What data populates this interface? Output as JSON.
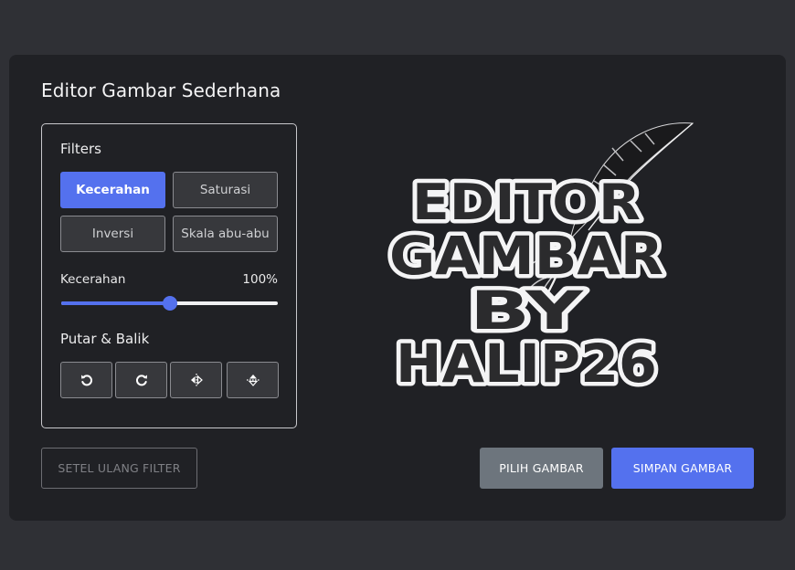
{
  "app": {
    "title": "Editor Gambar Sederhana"
  },
  "filters": {
    "heading": "Filters",
    "buttons": [
      {
        "label": "Kecerahan",
        "active": true
      },
      {
        "label": "Saturasi",
        "active": false
      },
      {
        "label": "Inversi",
        "active": false
      },
      {
        "label": "Skala abu-abu",
        "active": false
      }
    ],
    "slider": {
      "name": "Kecerahan",
      "value_text": "100%",
      "fraction": 0.5
    }
  },
  "rotate_flip": {
    "heading": "Putar & Balik",
    "icons": [
      "rotate-left-icon",
      "rotate-right-icon",
      "flip-horizontal-icon",
      "flip-vertical-icon"
    ]
  },
  "actions": {
    "reset": "SETEL ULANG FILTER",
    "choose": "PILIH GAMBAR",
    "save": "SIMPAN GAMBAR"
  },
  "preview_image": {
    "lines": [
      "EDITOR",
      "GAMBAR",
      "BY",
      "HALIP26"
    ]
  },
  "colors": {
    "accent": "#5471ee",
    "background": "#2f3035",
    "card": "#202125",
    "secondary_button": "#6d757d"
  }
}
